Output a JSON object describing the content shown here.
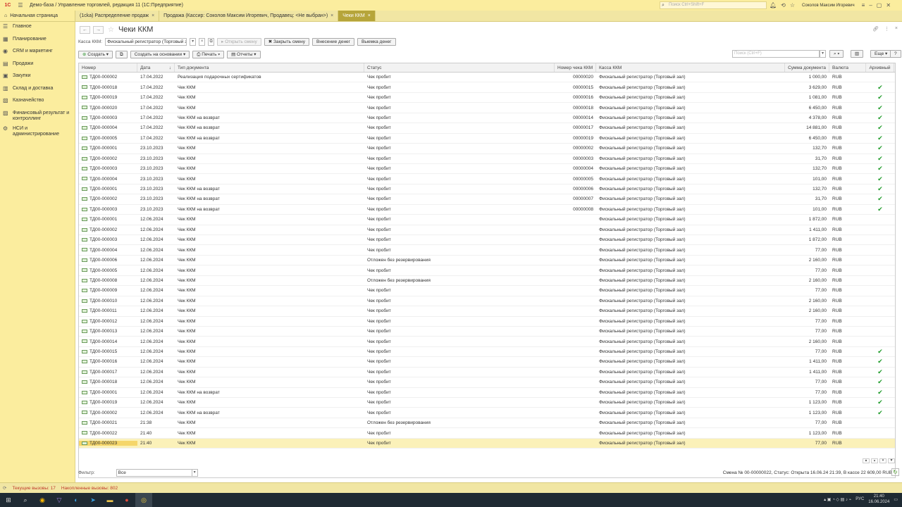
{
  "titlebar": {
    "logo": "1С",
    "title": "Демо-база / Управление торговлей, редакция 11  (1С:Предприятие)",
    "search_placeholder": "Поиск Ctrl+Shift+F",
    "user": "Соколов Максим Игоревич"
  },
  "tabs": [
    {
      "label": "Начальная страница"
    },
    {
      "label": "(1cka) Распределение продаж"
    },
    {
      "label": "Продажа (Кассир: Соколов Максим Игоревич, Продавец: <Не выбран>)"
    },
    {
      "label": "Чеки ККМ"
    }
  ],
  "sidebar": {
    "items": [
      {
        "label": "Главное",
        "icon": "menu-icon"
      },
      {
        "label": "Планирование",
        "icon": "planning-icon"
      },
      {
        "label": "CRM и маркетинг",
        "icon": "crm-icon"
      },
      {
        "label": "Продажи",
        "icon": "sales-icon"
      },
      {
        "label": "Закупки",
        "icon": "purchases-icon"
      },
      {
        "label": "Склад и доставка",
        "icon": "warehouse-icon"
      },
      {
        "label": "Казначейство",
        "icon": "treasury-icon"
      },
      {
        "label": "Финансовый результат и контроллинг",
        "icon": "finance-icon"
      },
      {
        "label": "НСИ и администрирование",
        "icon": "gear-icon"
      }
    ]
  },
  "page": {
    "title": "Чеки ККМ",
    "kassa_label": "Касса ККМ:",
    "kassa_value": "Фискальный регистратор (Торговый зал)",
    "btn_open_shift": "Открыть смену",
    "btn_close_shift": "Закрыть смену",
    "btn_deposit": "Внесение денег",
    "btn_withdraw": "Выемка денег",
    "btn_create": "Создать",
    "btn_create_based": "Создать на основании",
    "btn_print": "Печать",
    "btn_reports": "Отчеты",
    "search_placeholder": "Поиск (Ctrl+F)",
    "btn_more": "Еще",
    "btn_help": "?"
  },
  "table": {
    "headers": {
      "num": "Номер",
      "date": "Дата",
      "type": "Тип документа",
      "status": "Статус",
      "cno": "Номер чека ККМ",
      "kassa": "Касса ККМ",
      "sum": "Сумма документа",
      "cur": "Валюта",
      "arc": "Архивный"
    },
    "rows": [
      {
        "num": "ТД00-000002",
        "date": "17.04.2022",
        "type": "Реализация подарочных сертификатов",
        "status": "Чек пробит",
        "cno": "00000020",
        "kassa": "Фискальный регистратор (Торговый зал)",
        "sum": "1 000,00",
        "cur": "RUB",
        "arc": ""
      },
      {
        "num": "ТД00-000018",
        "date": "17.04.2022",
        "type": "Чек ККМ",
        "status": "Чек пробит",
        "cno": "00000015",
        "kassa": "Фискальный регистратор (Торговый зал)",
        "sum": "3 629,00",
        "cur": "RUB",
        "arc": "✔"
      },
      {
        "num": "ТД00-000019",
        "date": "17.04.2022",
        "type": "Чек ККМ",
        "status": "Чек пробит",
        "cno": "00000016",
        "kassa": "Фискальный регистратор (Торговый зал)",
        "sum": "1 081,00",
        "cur": "RUB",
        "arc": "✔"
      },
      {
        "num": "ТД00-000020",
        "date": "17.04.2022",
        "type": "Чек ККМ",
        "status": "Чек пробит",
        "cno": "00000018",
        "kassa": "Фискальный регистратор (Торговый зал)",
        "sum": "6 450,00",
        "cur": "RUB",
        "arc": "✔"
      },
      {
        "num": "ТД00-000003",
        "date": "17.04.2022",
        "type": "Чек ККМ на возврат",
        "status": "Чек пробит",
        "cno": "00000014",
        "kassa": "Фискальный регистратор (Торговый зал)",
        "sum": "4 378,00",
        "cur": "RUB",
        "arc": "✔"
      },
      {
        "num": "ТД00-000004",
        "date": "17.04.2022",
        "type": "Чек ККМ на возврат",
        "status": "Чек пробит",
        "cno": "00000017",
        "kassa": "Фискальный регистратор (Торговый зал)",
        "sum": "14 881,00",
        "cur": "RUB",
        "arc": "✔"
      },
      {
        "num": "ТД00-000005",
        "date": "17.04.2022",
        "type": "Чек ККМ на возврат",
        "status": "Чек пробит",
        "cno": "00000019",
        "kassa": "Фискальный регистратор (Торговый зал)",
        "sum": "6 450,00",
        "cur": "RUB",
        "arc": "✔"
      },
      {
        "num": "ТД00-000001",
        "date": "23.10.2023",
        "type": "Чек ККМ",
        "status": "Чек пробит",
        "cno": "00000002",
        "kassa": "Фискальный регистратор (Торговый зал)",
        "sum": "132,70",
        "cur": "RUB",
        "arc": "✔"
      },
      {
        "num": "ТД00-000002",
        "date": "23.10.2023",
        "type": "Чек ККМ",
        "status": "Чек пробит",
        "cno": "00000003",
        "kassa": "Фискальный регистратор (Торговый зал)",
        "sum": "31,70",
        "cur": "RUB",
        "arc": "✔"
      },
      {
        "num": "ТД00-000003",
        "date": "23.10.2023",
        "type": "Чек ККМ",
        "status": "Чек пробит",
        "cno": "00000004",
        "kassa": "Фискальный регистратор (Торговый зал)",
        "sum": "132,70",
        "cur": "RUB",
        "arc": "✔"
      },
      {
        "num": "ТД00-000004",
        "date": "23.10.2023",
        "type": "Чек ККМ",
        "status": "Чек пробит",
        "cno": "00000005",
        "kassa": "Фискальный регистратор (Торговый зал)",
        "sum": "101,00",
        "cur": "RUB",
        "arc": "✔"
      },
      {
        "num": "ТД00-000001",
        "date": "23.10.2023",
        "type": "Чек ККМ на возврат",
        "status": "Чек пробит",
        "cno": "00000006",
        "kassa": "Фискальный регистратор (Торговый зал)",
        "sum": "132,70",
        "cur": "RUB",
        "arc": "✔"
      },
      {
        "num": "ТД00-000002",
        "date": "23.10.2023",
        "type": "Чек ККМ на возврат",
        "status": "Чек пробит",
        "cno": "00000007",
        "kassa": "Фискальный регистратор (Торговый зал)",
        "sum": "31,70",
        "cur": "RUB",
        "arc": "✔"
      },
      {
        "num": "ТД00-000003",
        "date": "23.10.2023",
        "type": "Чек ККМ на возврат",
        "status": "Чек пробит",
        "cno": "00000008",
        "kassa": "Фискальный регистратор (Торговый зал)",
        "sum": "101,00",
        "cur": "RUB",
        "arc": "✔"
      },
      {
        "num": "ТД00-000001",
        "date": "12.06.2024",
        "type": "Чек ККМ",
        "status": "Чек пробит",
        "cno": "",
        "kassa": "Фискальный регистратор (Торговый зал)",
        "sum": "1 872,00",
        "cur": "RUB",
        "arc": ""
      },
      {
        "num": "ТД00-000002",
        "date": "12.06.2024",
        "type": "Чек ККМ",
        "status": "Чек пробит",
        "cno": "",
        "kassa": "Фискальный регистратор (Торговый зал)",
        "sum": "1 411,00",
        "cur": "RUB",
        "arc": ""
      },
      {
        "num": "ТД00-000003",
        "date": "12.06.2024",
        "type": "Чек ККМ",
        "status": "Чек пробит",
        "cno": "",
        "kassa": "Фискальный регистратор (Торговый зал)",
        "sum": "1 872,00",
        "cur": "RUB",
        "arc": ""
      },
      {
        "num": "ТД00-000004",
        "date": "12.06.2024",
        "type": "Чек ККМ",
        "status": "Чек пробит",
        "cno": "",
        "kassa": "Фискальный регистратор (Торговый зал)",
        "sum": "77,00",
        "cur": "RUB",
        "arc": ""
      },
      {
        "num": "ТД00-000006",
        "date": "12.06.2024",
        "type": "Чек ККМ",
        "status": "Отложен без резервирования",
        "cno": "",
        "kassa": "Фискальный регистратор (Торговый зал)",
        "sum": "2 160,00",
        "cur": "RUB",
        "arc": ""
      },
      {
        "num": "ТД00-000005",
        "date": "12.06.2024",
        "type": "Чек ККМ",
        "status": "Чек пробит",
        "cno": "",
        "kassa": "Фискальный регистратор (Торговый зал)",
        "sum": "77,00",
        "cur": "RUB",
        "arc": ""
      },
      {
        "num": "ТД00-000008",
        "date": "12.06.2024",
        "type": "Чек ККМ",
        "status": "Отложен без резервирования",
        "cno": "",
        "kassa": "Фискальный регистратор (Торговый зал)",
        "sum": "2 160,00",
        "cur": "RUB",
        "arc": ""
      },
      {
        "num": "ТД00-000009",
        "date": "12.06.2024",
        "type": "Чек ККМ",
        "status": "Чек пробит",
        "cno": "",
        "kassa": "Фискальный регистратор (Торговый зал)",
        "sum": "77,00",
        "cur": "RUB",
        "arc": ""
      },
      {
        "num": "ТД00-000010",
        "date": "12.06.2024",
        "type": "Чек ККМ",
        "status": "Чек пробит",
        "cno": "",
        "kassa": "Фискальный регистратор (Торговый зал)",
        "sum": "2 160,00",
        "cur": "RUB",
        "arc": ""
      },
      {
        "num": "ТД00-000011",
        "date": "12.06.2024",
        "type": "Чек ККМ",
        "status": "Чек пробит",
        "cno": "",
        "kassa": "Фискальный регистратор (Торговый зал)",
        "sum": "2 160,00",
        "cur": "RUB",
        "arc": ""
      },
      {
        "num": "ТД00-000012",
        "date": "12.06.2024",
        "type": "Чек ККМ",
        "status": "Чек пробит",
        "cno": "",
        "kassa": "Фискальный регистратор (Торговый зал)",
        "sum": "77,00",
        "cur": "RUB",
        "arc": ""
      },
      {
        "num": "ТД00-000013",
        "date": "12.06.2024",
        "type": "Чек ККМ",
        "status": "Чек пробит",
        "cno": "",
        "kassa": "Фискальный регистратор (Торговый зал)",
        "sum": "77,00",
        "cur": "RUB",
        "arc": ""
      },
      {
        "num": "ТД00-000014",
        "date": "12.06.2024",
        "type": "Чек ККМ",
        "status": "Чек пробит",
        "cno": "",
        "kassa": "Фискальный регистратор (Торговый зал)",
        "sum": "2 160,00",
        "cur": "RUB",
        "arc": ""
      },
      {
        "num": "ТД00-000015",
        "date": "12.06.2024",
        "type": "Чек ККМ",
        "status": "Чек пробит",
        "cno": "",
        "kassa": "Фискальный регистратор (Торговый зал)",
        "sum": "77,00",
        "cur": "RUB",
        "arc": "✔"
      },
      {
        "num": "ТД00-000016",
        "date": "12.06.2024",
        "type": "Чек ККМ",
        "status": "Чек пробит",
        "cno": "",
        "kassa": "Фискальный регистратор (Торговый зал)",
        "sum": "1 411,00",
        "cur": "RUB",
        "arc": "✔"
      },
      {
        "num": "ТД00-000017",
        "date": "12.06.2024",
        "type": "Чек ККМ",
        "status": "Чек пробит",
        "cno": "",
        "kassa": "Фискальный регистратор (Торговый зал)",
        "sum": "1 411,00",
        "cur": "RUB",
        "arc": "✔"
      },
      {
        "num": "ТД00-000018",
        "date": "12.06.2024",
        "type": "Чек ККМ",
        "status": "Чек пробит",
        "cno": "",
        "kassa": "Фискальный регистратор (Торговый зал)",
        "sum": "77,00",
        "cur": "RUB",
        "arc": "✔"
      },
      {
        "num": "ТД00-000001",
        "date": "12.06.2024",
        "type": "Чек ККМ на возврат",
        "status": "Чек пробит",
        "cno": "",
        "kassa": "Фискальный регистратор (Торговый зал)",
        "sum": "77,00",
        "cur": "RUB",
        "arc": "✔"
      },
      {
        "num": "ТД00-000019",
        "date": "12.06.2024",
        "type": "Чек ККМ",
        "status": "Чек пробит",
        "cno": "",
        "kassa": "Фискальный регистратор (Торговый зал)",
        "sum": "1 123,00",
        "cur": "RUB",
        "arc": "✔"
      },
      {
        "num": "ТД00-000002",
        "date": "12.06.2024",
        "type": "Чек ККМ на возврат",
        "status": "Чек пробит",
        "cno": "",
        "kassa": "Фискальный регистратор (Торговый зал)",
        "sum": "1 123,00",
        "cur": "RUB",
        "arc": "✔"
      },
      {
        "num": "ТД00-000021",
        "date": "21:38",
        "type": "Чек ККМ",
        "status": "Отложен без резервирования",
        "cno": "",
        "kassa": "Фискальный регистратор (Торговый зал)",
        "sum": "77,00",
        "cur": "RUB",
        "arc": ""
      },
      {
        "num": "ТД00-000022",
        "date": "21:40",
        "type": "Чек ККМ",
        "status": "Чек пробит",
        "cno": "",
        "kassa": "Фискальный регистратор (Торговый зал)",
        "sum": "1 123,00",
        "cur": "RUB",
        "arc": ""
      },
      {
        "num": "ТД00-000023",
        "date": "21:40",
        "type": "Чек ККМ",
        "status": "Чек пробит",
        "cno": "",
        "kassa": "Фискальный регистратор (Торговый зал)",
        "sum": "77,00",
        "cur": "RUB",
        "arc": "",
        "selected": true
      }
    ]
  },
  "footer": {
    "filter_label": "Фильтр:",
    "filter_value": "Все",
    "shift_status": "Смена № 00-00000022, Статус: Открыта 16.06.24 21:39, В кассе 22 609,00 RUB"
  },
  "bottombar": {
    "current_calls": "Текущие вызовы: 17",
    "accumulated_calls": "Накопленные вызовы: 802"
  },
  "taskbar": {
    "lang": "РУС",
    "time": "21:40",
    "date": "16.06.2024"
  }
}
